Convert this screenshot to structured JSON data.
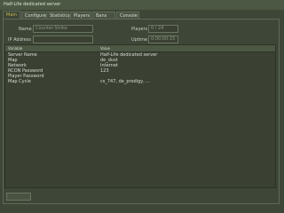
{
  "window": {
    "title": "Half-Life dedicated server"
  },
  "tabs": [
    {
      "label": "Main"
    },
    {
      "label": "Configure"
    },
    {
      "label": "Statistics"
    },
    {
      "label": "Players"
    },
    {
      "label": "Bans"
    },
    {
      "label": "Console"
    }
  ],
  "main": {
    "name_label": "Name",
    "name_value": "Counter-Strike",
    "ip_label": "IP Address",
    "ip_value": "",
    "players_label": "Players",
    "players_value": "0 / 24",
    "uptime_label": "Uptime",
    "uptime_value": "0:00:00:15"
  },
  "table": {
    "columns": [
      "Variable",
      "Value"
    ],
    "rows": [
      {
        "variable": "Server Name",
        "value": "Half-Life dedicated server"
      },
      {
        "variable": "Map",
        "value": "de_dust"
      },
      {
        "variable": "Network",
        "value": "Internet"
      },
      {
        "variable": "RCON Password",
        "value": "123"
      },
      {
        "variable": "Player Password",
        "value": ""
      },
      {
        "variable": "Map Cycle",
        "value": "cs_747, de_prodigy, ..."
      }
    ]
  },
  "footer": {
    "button_label": ""
  }
}
